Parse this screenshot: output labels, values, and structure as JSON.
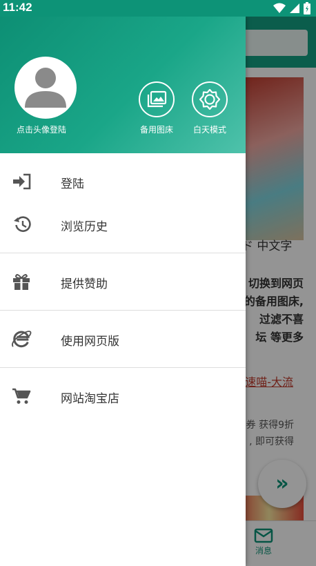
{
  "status_bar": {
    "time": "11:42"
  },
  "background_app": {
    "title_fragment": "ド 中文字",
    "paragraph_lines": [
      "切换到网页",
      "的备用图床,",
      "过滤不喜",
      "坛 等更多"
    ],
    "link_text": "速喵-大流",
    "promo_lines": [
      "券 获得9折",
      ", 即可获得"
    ],
    "fab_icon": "»",
    "nav_messages_label": "消息"
  },
  "drawer": {
    "avatar_label": "点击头像登陆",
    "backup_image_label": "备用图床",
    "day_mode_label": "白天模式",
    "menu": [
      {
        "icon": "login-icon",
        "label": "登陆"
      },
      {
        "icon": "history-icon",
        "label": "浏览历史"
      },
      {
        "icon": "gift-icon",
        "label": "提供赞助"
      },
      {
        "icon": "browser-icon",
        "label": "使用网页版"
      },
      {
        "icon": "cart-icon",
        "label": "网站淘宝店"
      }
    ]
  },
  "colors": {
    "primary": "#0d9377",
    "header_gradient_end": "#4fc2ab",
    "icon_gray": "#555555"
  }
}
